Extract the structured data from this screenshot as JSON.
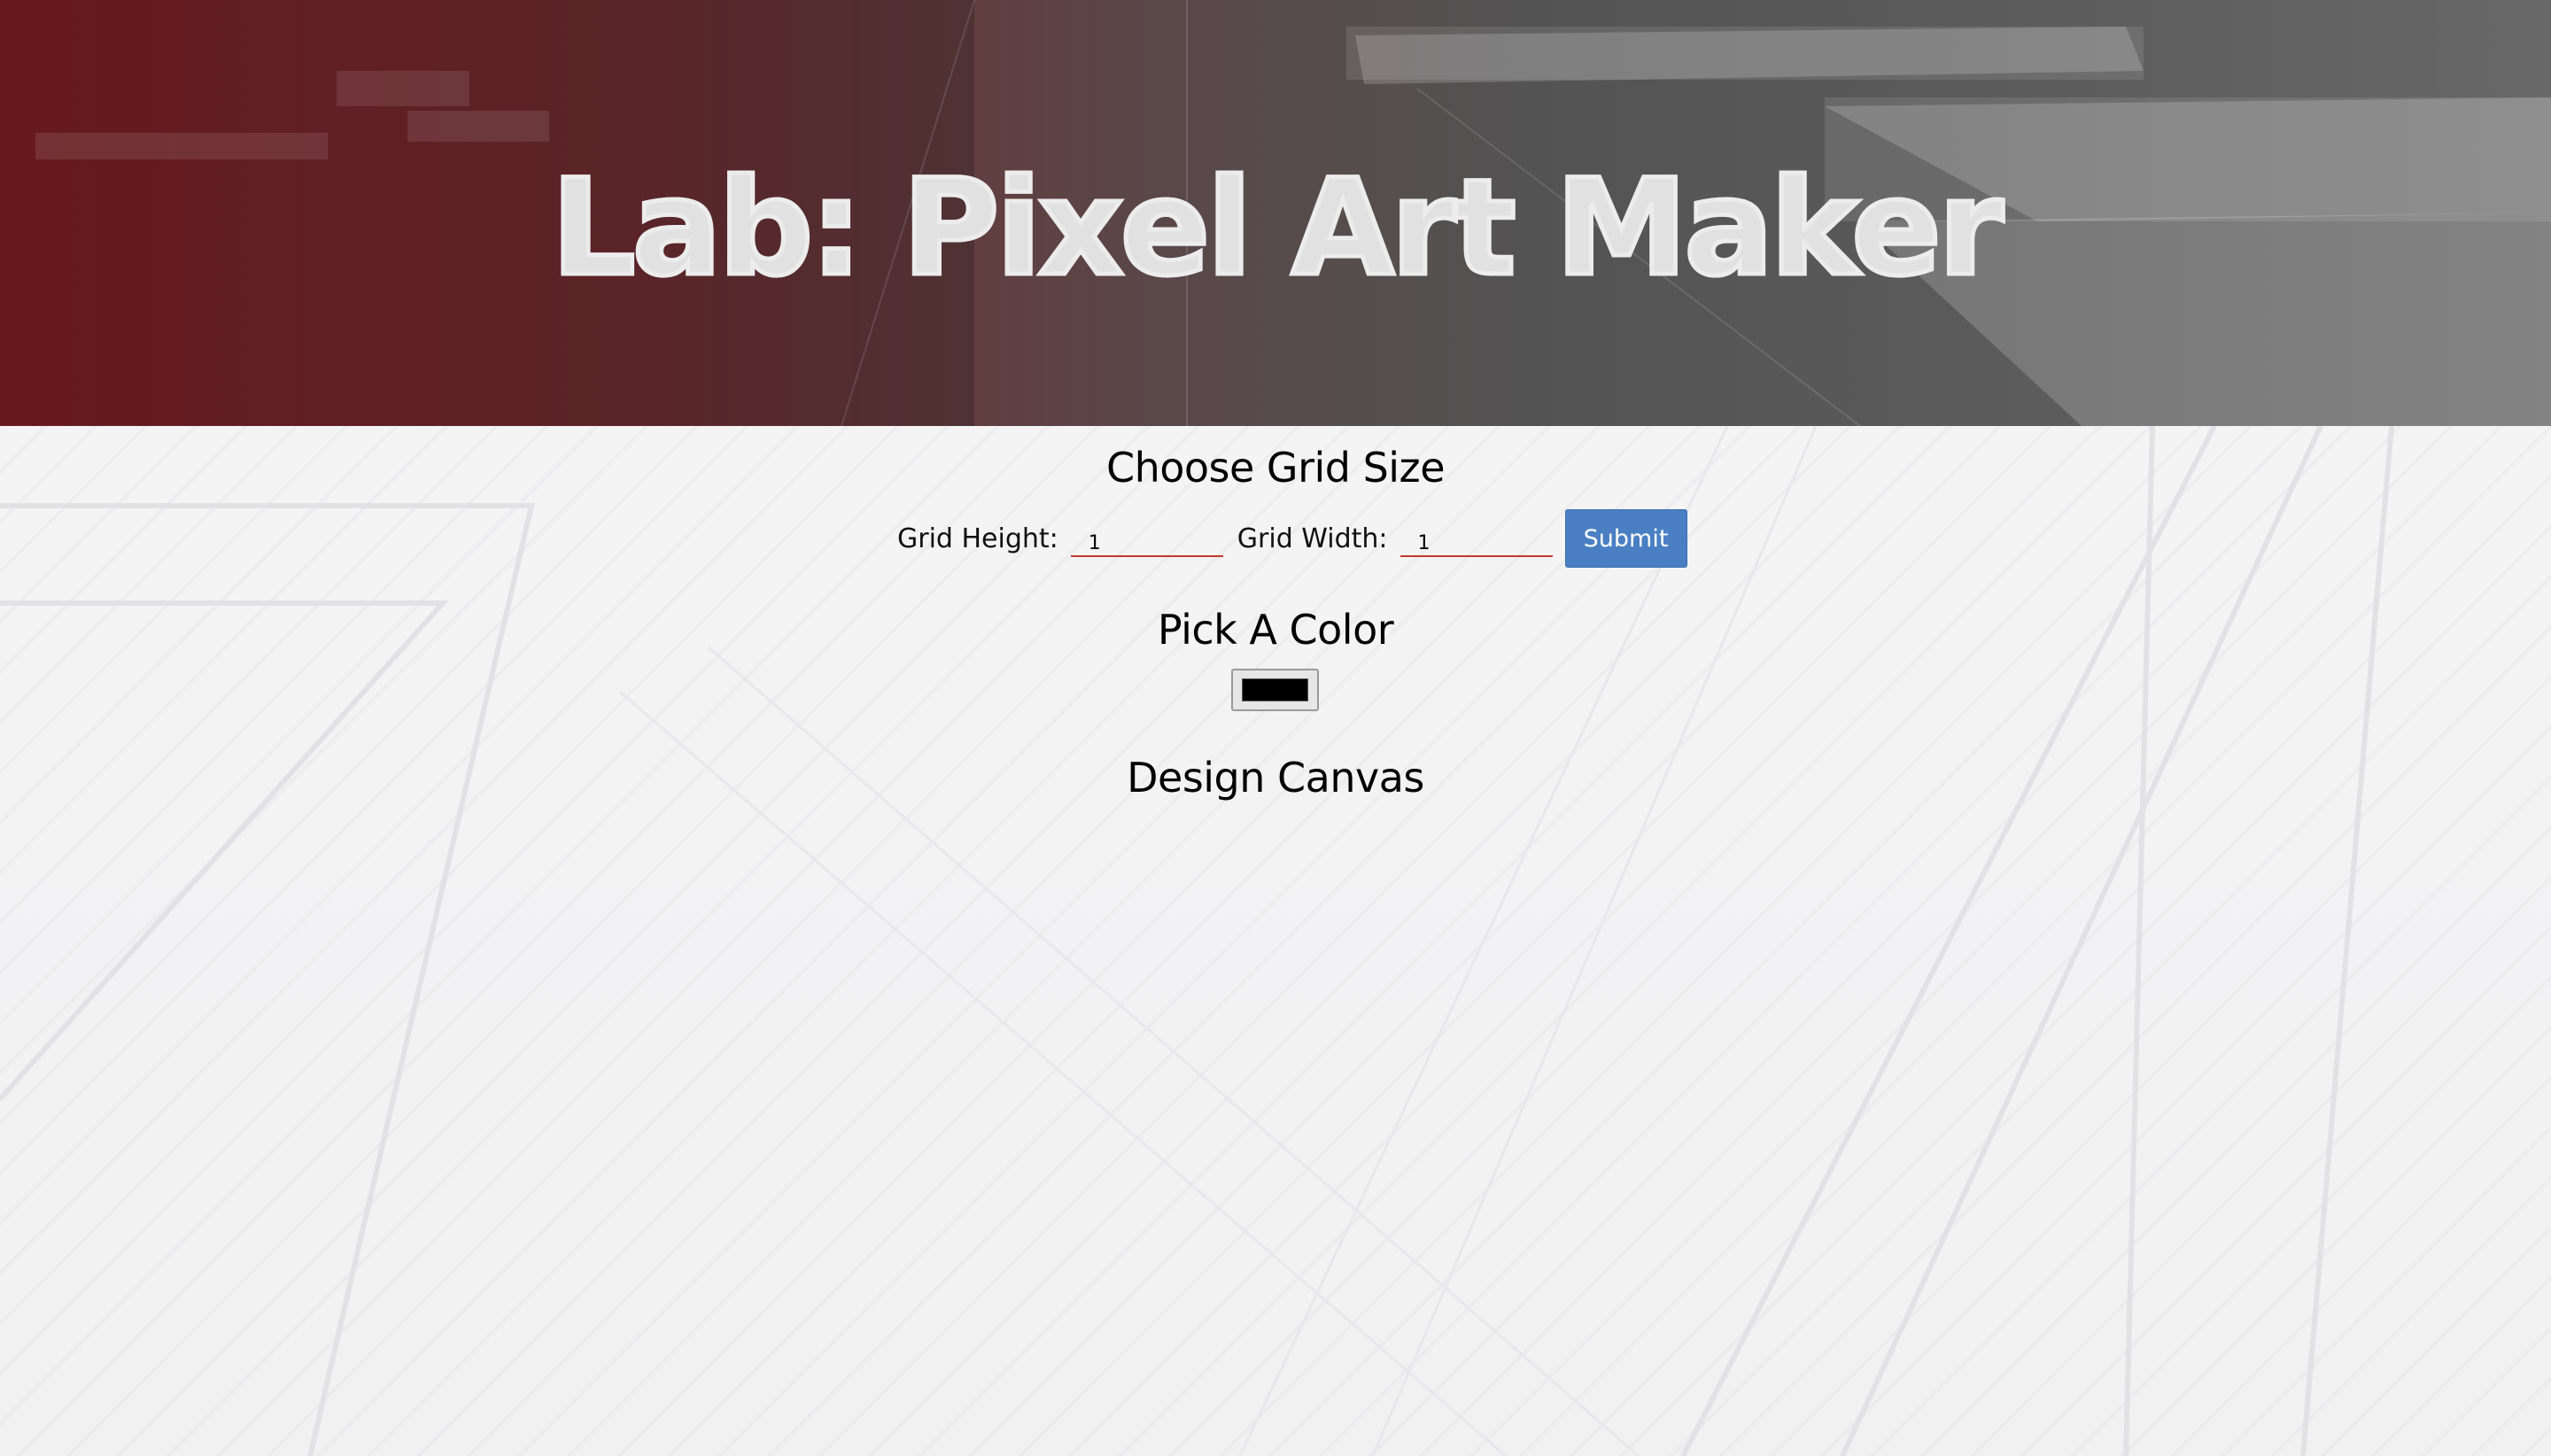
{
  "header": {
    "title": "Lab: Pixel Art Maker"
  },
  "grid_size": {
    "heading": "Choose Grid Size",
    "height_label": "Grid Height:",
    "height_value": "1",
    "width_label": "Grid Width:",
    "width_value": "1",
    "submit_label": "Submit"
  },
  "color": {
    "heading": "Pick A Color",
    "value": "#000000"
  },
  "canvas": {
    "heading": "Design Canvas"
  },
  "colors": {
    "header_red": "#7e1f26",
    "header_gray": "#5c5c5c",
    "input_underline": "#c0392b",
    "button_blue": "#4a7fc4"
  }
}
